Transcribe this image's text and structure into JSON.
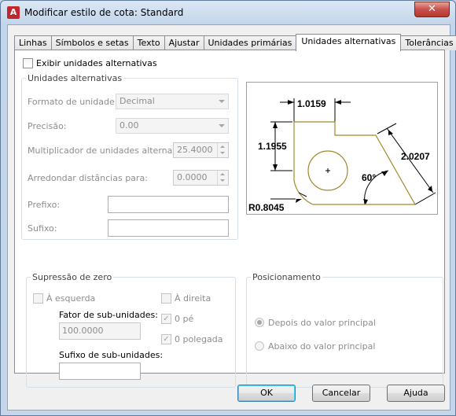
{
  "window": {
    "title": "Modificar estilo de cota: Standard",
    "close_label": "✕"
  },
  "tabs": [
    "Linhas",
    "Símbolos e setas",
    "Texto",
    "Ajustar",
    "Unidades primárias",
    "Unidades alternativas",
    "Tolerâncias"
  ],
  "active_tab": 5,
  "display_alt": {
    "label": "Exibir unidades alternativas",
    "checked": false
  },
  "alt_units": {
    "group_label": "Unidades alternativas",
    "unit_format_label": "Formato de unidade:",
    "unit_format_value": "Decimal",
    "precision_label": "Precisão:",
    "precision_value": "0.00",
    "multiplier_label": "Multiplicador de unidades alternativas:",
    "multiplier_value": "25.4000",
    "round_label": "Arredondar distâncias para:",
    "round_value": "0.0000",
    "prefix_label": "Prefixo:",
    "prefix_value": "",
    "suffix_label": "Sufixo:",
    "suffix_value": ""
  },
  "zero_suppression": {
    "group_label": "Supressão de zero",
    "leading_label": "À esquerda",
    "leading_checked": false,
    "trailing_label": "À direita",
    "trailing_checked": false,
    "sub_factor_label": "Fator de sub-unidades:",
    "sub_factor_value": "100.0000",
    "sub_suffix_label": "Sufixo de sub-unidades:",
    "sub_suffix_value": "",
    "zero_feet_label": "0 pé",
    "zero_feet_checked": true,
    "zero_inches_label": "0 polegada",
    "zero_inches_checked": true
  },
  "placement": {
    "group_label": "Posicionamento",
    "after_label": "Depois do valor principal",
    "after_selected": true,
    "below_label": "Abaixo do valor principal",
    "below_selected": false
  },
  "preview": {
    "dim_top": "1.0159",
    "dim_left": "1.1955",
    "dim_right": "2.0207",
    "angle": "60°",
    "radius": "R0.8045",
    "shape_color": "#a08a2a"
  },
  "buttons": {
    "ok": "OK",
    "cancel": "Cancelar",
    "help": "Ajuda"
  }
}
